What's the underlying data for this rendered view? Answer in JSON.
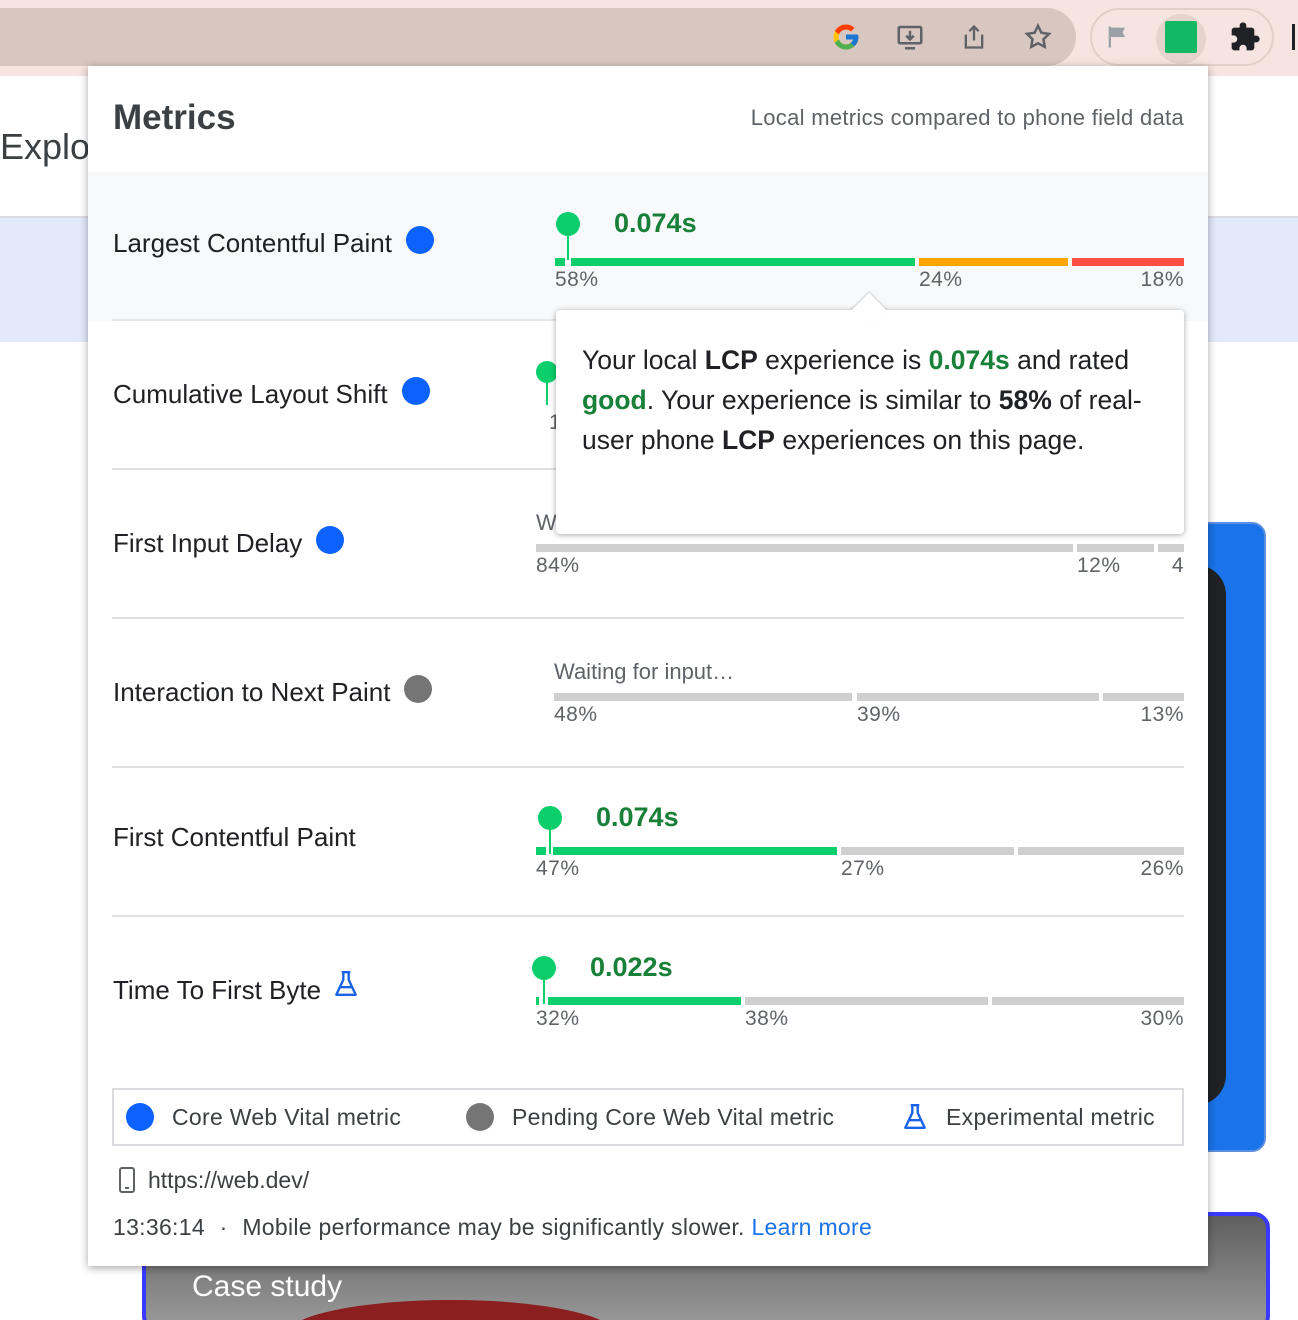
{
  "background": {
    "title_fragment": "Explor",
    "case_label": "Case study"
  },
  "popup": {
    "title": "Metrics",
    "subtitle": "Local metrics compared to phone field data"
  },
  "metrics": [
    {
      "name": "Largest Contentful Paint",
      "indicator": "core-web-vital",
      "value": "0.074s",
      "distribution": [
        58,
        24,
        18
      ],
      "labels": [
        "58%",
        "24%",
        "18%"
      ]
    },
    {
      "name": "Cumulative Layout Shift",
      "indicator": "core-web-vital",
      "label_fragment": "1"
    },
    {
      "name": "First Input Delay",
      "indicator": "core-web-vital",
      "status_fragment": "W",
      "distribution": [
        84,
        12,
        4
      ],
      "labels": [
        "84%",
        "12%",
        "4"
      ]
    },
    {
      "name": "Interaction to Next Paint",
      "indicator": "pending-core-web-vital",
      "status": "Waiting for input…",
      "distribution": [
        48,
        39,
        13
      ],
      "labels": [
        "48%",
        "39%",
        "13%"
      ]
    },
    {
      "name": "First Contentful Paint",
      "indicator": "none",
      "value": "0.074s",
      "distribution": [
        47,
        27,
        26
      ],
      "labels": [
        "47%",
        "27%",
        "26%"
      ]
    },
    {
      "name": "Time To First Byte",
      "indicator": "experimental",
      "value": "0.022s",
      "distribution": [
        32,
        38,
        30
      ],
      "labels": [
        "32%",
        "38%",
        "30%"
      ]
    }
  ],
  "tooltip": {
    "t1": "Your local ",
    "metric": "LCP",
    "t2": " experience is ",
    "value": "0.074s",
    "t3": " and rated ",
    "rating": "good",
    "t4": ". Your experience is similar to ",
    "pct": "58%",
    "t5": " of real-user phone ",
    "metric2": "LCP",
    "t6": " experiences on this page."
  },
  "legend": {
    "core": "Core Web Vital metric",
    "pending": "Pending Core Web Vital metric",
    "experimental": "Experimental metric"
  },
  "footer": {
    "url": "https://web.dev/",
    "time": "13:36:14",
    "separator": "·",
    "note": "Mobile performance may be significantly slower.",
    "link": "Learn more"
  },
  "colors": {
    "good": "#0cce6b",
    "needs_improvement": "#ffa400",
    "poor": "#ff4e42",
    "core_dot": "#0b62ff",
    "pending_dot": "#757575",
    "link": "#1a73e8"
  },
  "toolbar_icons": [
    "google-icon",
    "install-icon",
    "share-icon",
    "bookmark-star-icon",
    "flag-icon",
    "web-vitals-extension-icon",
    "extensions-puzzle-icon"
  ]
}
